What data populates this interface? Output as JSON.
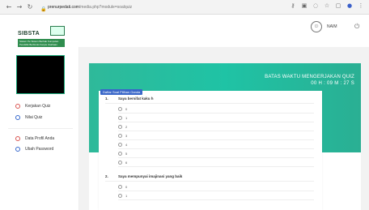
{
  "browser": {
    "url_host": "prenurpedati.com",
    "url_path": "/media.php?module=soalquiz",
    "user_name": "NAIM"
  },
  "sidebar": {
    "items": [
      {
        "label": "Kerjakan Quiz"
      },
      {
        "label": "Nilai Quiz"
      },
      {
        "label": "Data Profil Anda"
      },
      {
        "label": "Ubah Password"
      }
    ]
  },
  "logo": {
    "title": "SIBSTA",
    "subtitle": "Sistem Pe Sistem Berhak Kumpulan Pendidik Berbisnis Kerjus Usahaan"
  },
  "quiz": {
    "deadline_label": "BATAS WAKTU MENGERJAKAN QUIZ",
    "deadline_time": "00 H : 09 M : 27 S",
    "list_title": "Daftar Soal Pilihan Ganda",
    "questions": [
      {
        "num": "1.",
        "text": "Saya bersifat kaku h",
        "options": [
          "0",
          "1",
          "2",
          "3",
          "4",
          "5",
          "6"
        ]
      },
      {
        "num": "2.",
        "text": "Saya mempunyai imajinasi yang baik",
        "options": [
          "0",
          "1"
        ]
      }
    ]
  }
}
